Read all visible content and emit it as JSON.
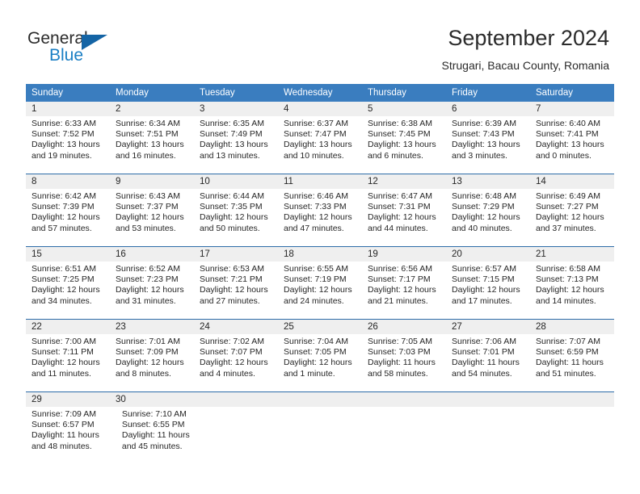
{
  "brand": {
    "name_part1": "General",
    "name_part2": "Blue",
    "accent_color": "#1464a5",
    "blue_text_color": "#1b7fc4"
  },
  "header": {
    "title": "September 2024",
    "location": "Strugari, Bacau County, Romania"
  },
  "theme": {
    "header_row_bg": "#3a7dbf",
    "daynum_band_bg": "#efefef",
    "separator_color": "#2d6ca8",
    "text_color": "#262626"
  },
  "weekdays": [
    "Sunday",
    "Monday",
    "Tuesday",
    "Wednesday",
    "Thursday",
    "Friday",
    "Saturday"
  ],
  "weeks": [
    {
      "days": [
        {
          "num": "1",
          "sunrise": "Sunrise: 6:33 AM",
          "sunset": "Sunset: 7:52 PM",
          "daylight1": "Daylight: 13 hours",
          "daylight2": "and 19 minutes."
        },
        {
          "num": "2",
          "sunrise": "Sunrise: 6:34 AM",
          "sunset": "Sunset: 7:51 PM",
          "daylight1": "Daylight: 13 hours",
          "daylight2": "and 16 minutes."
        },
        {
          "num": "3",
          "sunrise": "Sunrise: 6:35 AM",
          "sunset": "Sunset: 7:49 PM",
          "daylight1": "Daylight: 13 hours",
          "daylight2": "and 13 minutes."
        },
        {
          "num": "4",
          "sunrise": "Sunrise: 6:37 AM",
          "sunset": "Sunset: 7:47 PM",
          "daylight1": "Daylight: 13 hours",
          "daylight2": "and 10 minutes."
        },
        {
          "num": "5",
          "sunrise": "Sunrise: 6:38 AM",
          "sunset": "Sunset: 7:45 PM",
          "daylight1": "Daylight: 13 hours",
          "daylight2": "and 6 minutes."
        },
        {
          "num": "6",
          "sunrise": "Sunrise: 6:39 AM",
          "sunset": "Sunset: 7:43 PM",
          "daylight1": "Daylight: 13 hours",
          "daylight2": "and 3 minutes."
        },
        {
          "num": "7",
          "sunrise": "Sunrise: 6:40 AM",
          "sunset": "Sunset: 7:41 PM",
          "daylight1": "Daylight: 13 hours",
          "daylight2": "and 0 minutes."
        }
      ]
    },
    {
      "days": [
        {
          "num": "8",
          "sunrise": "Sunrise: 6:42 AM",
          "sunset": "Sunset: 7:39 PM",
          "daylight1": "Daylight: 12 hours",
          "daylight2": "and 57 minutes."
        },
        {
          "num": "9",
          "sunrise": "Sunrise: 6:43 AM",
          "sunset": "Sunset: 7:37 PM",
          "daylight1": "Daylight: 12 hours",
          "daylight2": "and 53 minutes."
        },
        {
          "num": "10",
          "sunrise": "Sunrise: 6:44 AM",
          "sunset": "Sunset: 7:35 PM",
          "daylight1": "Daylight: 12 hours",
          "daylight2": "and 50 minutes."
        },
        {
          "num": "11",
          "sunrise": "Sunrise: 6:46 AM",
          "sunset": "Sunset: 7:33 PM",
          "daylight1": "Daylight: 12 hours",
          "daylight2": "and 47 minutes."
        },
        {
          "num": "12",
          "sunrise": "Sunrise: 6:47 AM",
          "sunset": "Sunset: 7:31 PM",
          "daylight1": "Daylight: 12 hours",
          "daylight2": "and 44 minutes."
        },
        {
          "num": "13",
          "sunrise": "Sunrise: 6:48 AM",
          "sunset": "Sunset: 7:29 PM",
          "daylight1": "Daylight: 12 hours",
          "daylight2": "and 40 minutes."
        },
        {
          "num": "14",
          "sunrise": "Sunrise: 6:49 AM",
          "sunset": "Sunset: 7:27 PM",
          "daylight1": "Daylight: 12 hours",
          "daylight2": "and 37 minutes."
        }
      ]
    },
    {
      "days": [
        {
          "num": "15",
          "sunrise": "Sunrise: 6:51 AM",
          "sunset": "Sunset: 7:25 PM",
          "daylight1": "Daylight: 12 hours",
          "daylight2": "and 34 minutes."
        },
        {
          "num": "16",
          "sunrise": "Sunrise: 6:52 AM",
          "sunset": "Sunset: 7:23 PM",
          "daylight1": "Daylight: 12 hours",
          "daylight2": "and 31 minutes."
        },
        {
          "num": "17",
          "sunrise": "Sunrise: 6:53 AM",
          "sunset": "Sunset: 7:21 PM",
          "daylight1": "Daylight: 12 hours",
          "daylight2": "and 27 minutes."
        },
        {
          "num": "18",
          "sunrise": "Sunrise: 6:55 AM",
          "sunset": "Sunset: 7:19 PM",
          "daylight1": "Daylight: 12 hours",
          "daylight2": "and 24 minutes."
        },
        {
          "num": "19",
          "sunrise": "Sunrise: 6:56 AM",
          "sunset": "Sunset: 7:17 PM",
          "daylight1": "Daylight: 12 hours",
          "daylight2": "and 21 minutes."
        },
        {
          "num": "20",
          "sunrise": "Sunrise: 6:57 AM",
          "sunset": "Sunset: 7:15 PM",
          "daylight1": "Daylight: 12 hours",
          "daylight2": "and 17 minutes."
        },
        {
          "num": "21",
          "sunrise": "Sunrise: 6:58 AM",
          "sunset": "Sunset: 7:13 PM",
          "daylight1": "Daylight: 12 hours",
          "daylight2": "and 14 minutes."
        }
      ]
    },
    {
      "days": [
        {
          "num": "22",
          "sunrise": "Sunrise: 7:00 AM",
          "sunset": "Sunset: 7:11 PM",
          "daylight1": "Daylight: 12 hours",
          "daylight2": "and 11 minutes."
        },
        {
          "num": "23",
          "sunrise": "Sunrise: 7:01 AM",
          "sunset": "Sunset: 7:09 PM",
          "daylight1": "Daylight: 12 hours",
          "daylight2": "and 8 minutes."
        },
        {
          "num": "24",
          "sunrise": "Sunrise: 7:02 AM",
          "sunset": "Sunset: 7:07 PM",
          "daylight1": "Daylight: 12 hours",
          "daylight2": "and 4 minutes."
        },
        {
          "num": "25",
          "sunrise": "Sunrise: 7:04 AM",
          "sunset": "Sunset: 7:05 PM",
          "daylight1": "Daylight: 12 hours",
          "daylight2": "and 1 minute."
        },
        {
          "num": "26",
          "sunrise": "Sunrise: 7:05 AM",
          "sunset": "Sunset: 7:03 PM",
          "daylight1": "Daylight: 11 hours",
          "daylight2": "and 58 minutes."
        },
        {
          "num": "27",
          "sunrise": "Sunrise: 7:06 AM",
          "sunset": "Sunset: 7:01 PM",
          "daylight1": "Daylight: 11 hours",
          "daylight2": "and 54 minutes."
        },
        {
          "num": "28",
          "sunrise": "Sunrise: 7:07 AM",
          "sunset": "Sunset: 6:59 PM",
          "daylight1": "Daylight: 11 hours",
          "daylight2": "and 51 minutes."
        }
      ]
    },
    {
      "days": [
        {
          "num": "29",
          "sunrise": "Sunrise: 7:09 AM",
          "sunset": "Sunset: 6:57 PM",
          "daylight1": "Daylight: 11 hours",
          "daylight2": "and 48 minutes."
        },
        {
          "num": "30",
          "sunrise": "Sunrise: 7:10 AM",
          "sunset": "Sunset: 6:55 PM",
          "daylight1": "Daylight: 11 hours",
          "daylight2": "and 45 minutes."
        },
        {
          "num": "",
          "sunrise": "",
          "sunset": "",
          "daylight1": "",
          "daylight2": ""
        },
        {
          "num": "",
          "sunrise": "",
          "sunset": "",
          "daylight1": "",
          "daylight2": ""
        },
        {
          "num": "",
          "sunrise": "",
          "sunset": "",
          "daylight1": "",
          "daylight2": ""
        },
        {
          "num": "",
          "sunrise": "",
          "sunset": "",
          "daylight1": "",
          "daylight2": ""
        },
        {
          "num": "",
          "sunrise": "",
          "sunset": "",
          "daylight1": "",
          "daylight2": ""
        }
      ]
    }
  ]
}
